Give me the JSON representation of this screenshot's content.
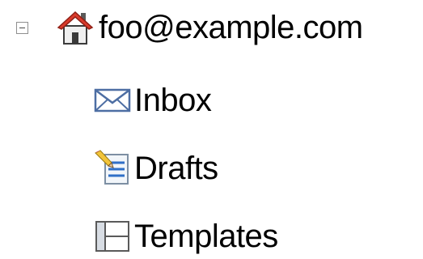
{
  "tree": {
    "account": {
      "label": "foo@example.com",
      "expanded": true,
      "icon": "home-icon",
      "toggle_icon": "collapse-minus-icon"
    },
    "folders": [
      {
        "label": "Inbox",
        "icon": "envelope-icon"
      },
      {
        "label": "Drafts",
        "icon": "notepad-pencil-icon"
      },
      {
        "label": "Templates",
        "icon": "template-icon"
      }
    ]
  },
  "colors": {
    "roof": "#d93a2b",
    "house_body": "#e9e9e9",
    "envelope_stroke": "#4d6ea3",
    "text": "#000000"
  }
}
